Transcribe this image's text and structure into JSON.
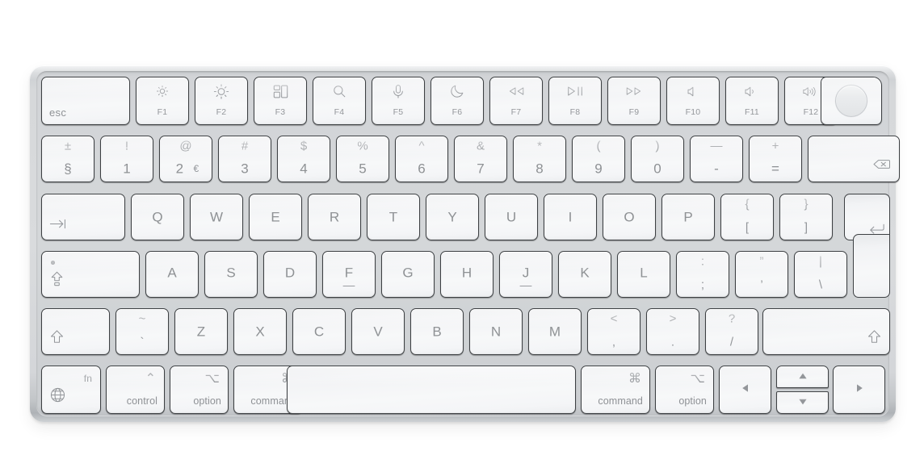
{
  "device": {
    "name": "Magic Keyboard with Touch ID",
    "layout": "ISO British",
    "body_color": "#d4d7d9",
    "key_color": "#f4f5f7",
    "legend_color": "#8e9194",
    "key_border_color": "#3d4043"
  },
  "rows": {
    "function_row": [
      {
        "id": "esc",
        "main": "esc",
        "icon": null,
        "sub": null
      },
      {
        "id": "f1",
        "main": null,
        "icon": "brightness-down-icon",
        "sub": "F1"
      },
      {
        "id": "f2",
        "main": null,
        "icon": "brightness-up-icon",
        "sub": "F2"
      },
      {
        "id": "f3",
        "main": null,
        "icon": "mission-control-icon",
        "sub": "F3"
      },
      {
        "id": "f4",
        "main": null,
        "icon": "spotlight-search-icon",
        "sub": "F4"
      },
      {
        "id": "f5",
        "main": null,
        "icon": "dictation-mic-icon",
        "sub": "F5"
      },
      {
        "id": "f6",
        "main": null,
        "icon": "do-not-disturb-moon-icon",
        "sub": "F6"
      },
      {
        "id": "f7",
        "main": null,
        "icon": "rewind-icon",
        "sub": "F7"
      },
      {
        "id": "f8",
        "main": null,
        "icon": "play-pause-icon",
        "sub": "F8"
      },
      {
        "id": "f9",
        "main": null,
        "icon": "fast-forward-icon",
        "sub": "F9"
      },
      {
        "id": "f10",
        "main": null,
        "icon": "volume-mute-icon",
        "sub": "F10"
      },
      {
        "id": "f11",
        "main": null,
        "icon": "volume-down-icon",
        "sub": "F11"
      },
      {
        "id": "f12",
        "main": null,
        "icon": "volume-up-icon",
        "sub": "F12"
      },
      {
        "id": "touch-id",
        "main": null,
        "icon": "touch-id-icon",
        "sub": null
      }
    ],
    "number_row": [
      {
        "id": "section",
        "top": "±",
        "bottom": "§"
      },
      {
        "id": "1",
        "top": "!",
        "bottom": "1"
      },
      {
        "id": "2",
        "top": "@",
        "bottom": "2",
        "extra": "€"
      },
      {
        "id": "3",
        "top": "#",
        "bottom": "3"
      },
      {
        "id": "4",
        "top": "$",
        "bottom": "4"
      },
      {
        "id": "5",
        "top": "%",
        "bottom": "5"
      },
      {
        "id": "6",
        "top": "^",
        "bottom": "6"
      },
      {
        "id": "7",
        "top": "&",
        "bottom": "7"
      },
      {
        "id": "8",
        "top": "*",
        "bottom": "8"
      },
      {
        "id": "9",
        "top": "(",
        "bottom": "9"
      },
      {
        "id": "0",
        "top": ")",
        "bottom": "0"
      },
      {
        "id": "minus",
        "top": "—",
        "bottom": "-"
      },
      {
        "id": "equal",
        "top": "+",
        "bottom": "="
      },
      {
        "id": "delete",
        "icon": "delete-backspace-icon"
      }
    ],
    "top_row": [
      {
        "id": "tab",
        "icon": "tab-icon"
      },
      {
        "id": "q",
        "main": "Q"
      },
      {
        "id": "w",
        "main": "W"
      },
      {
        "id": "e",
        "main": "E"
      },
      {
        "id": "r",
        "main": "R"
      },
      {
        "id": "t",
        "main": "T"
      },
      {
        "id": "y",
        "main": "Y"
      },
      {
        "id": "u",
        "main": "U"
      },
      {
        "id": "i",
        "main": "I"
      },
      {
        "id": "o",
        "main": "O"
      },
      {
        "id": "p",
        "main": "P"
      },
      {
        "id": "bracket-left",
        "top": "{",
        "bottom": "["
      },
      {
        "id": "bracket-right",
        "top": "}",
        "bottom": "]"
      },
      {
        "id": "return",
        "icon": "return-enter-icon"
      }
    ],
    "home_row": [
      {
        "id": "caps-lock",
        "icon": "caps-lock-icon",
        "led": true
      },
      {
        "id": "a",
        "main": "A"
      },
      {
        "id": "s",
        "main": "S"
      },
      {
        "id": "d",
        "main": "D"
      },
      {
        "id": "f",
        "main": "F",
        "bump": true
      },
      {
        "id": "g",
        "main": "G"
      },
      {
        "id": "h",
        "main": "H"
      },
      {
        "id": "j",
        "main": "J",
        "bump": true
      },
      {
        "id": "k",
        "main": "K"
      },
      {
        "id": "l",
        "main": "L"
      },
      {
        "id": "semicolon",
        "top": ":",
        "bottom": ";"
      },
      {
        "id": "quote",
        "top": "”",
        "bottom": "’"
      },
      {
        "id": "backslash",
        "top": "|",
        "bottom": "\\"
      }
    ],
    "shift_row": [
      {
        "id": "shift-left",
        "icon": "shift-icon"
      },
      {
        "id": "grave",
        "top": "~",
        "bottom": "`"
      },
      {
        "id": "z",
        "main": "Z"
      },
      {
        "id": "x",
        "main": "X"
      },
      {
        "id": "c",
        "main": "C"
      },
      {
        "id": "v",
        "main": "V"
      },
      {
        "id": "b",
        "main": "B"
      },
      {
        "id": "n",
        "main": "N"
      },
      {
        "id": "m",
        "main": "M"
      },
      {
        "id": "comma",
        "top": "<",
        "bottom": ","
      },
      {
        "id": "period",
        "top": ">",
        "bottom": "."
      },
      {
        "id": "slash",
        "top": "?",
        "bottom": "/"
      },
      {
        "id": "shift-right",
        "icon": "shift-icon"
      }
    ],
    "bottom_row": [
      {
        "id": "fn",
        "top_text": "fn",
        "icon": "globe-icon"
      },
      {
        "id": "control-left",
        "symbol": "⌃",
        "word": "control"
      },
      {
        "id": "option-left",
        "symbol": "⌥",
        "word": "option"
      },
      {
        "id": "command-left",
        "symbol": "⌘",
        "word": "command"
      },
      {
        "id": "space",
        "main": null
      },
      {
        "id": "command-right",
        "symbol": "⌘",
        "word": "command"
      },
      {
        "id": "option-right",
        "symbol": "⌥",
        "word": "option"
      },
      {
        "id": "arrow-left",
        "icon": "arrow-left-icon"
      },
      {
        "id": "arrow-up",
        "icon": "arrow-up-icon"
      },
      {
        "id": "arrow-down",
        "icon": "arrow-down-icon"
      },
      {
        "id": "arrow-right",
        "icon": "arrow-right-icon"
      }
    ]
  }
}
